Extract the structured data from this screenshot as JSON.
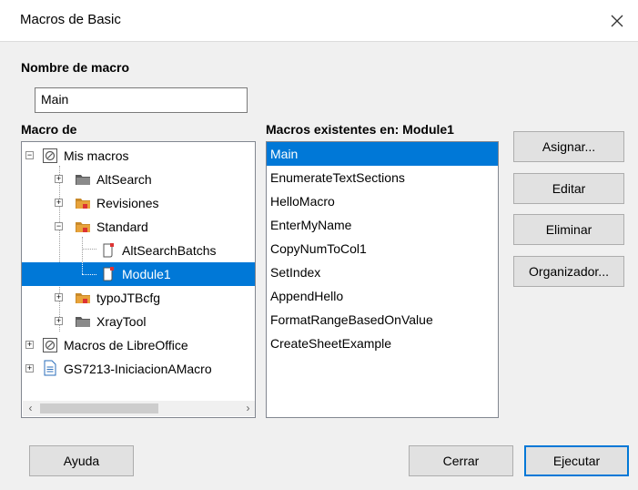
{
  "window": {
    "title": "Macros de Basic"
  },
  "macro_name": {
    "label": "Nombre de macro",
    "value": "Main"
  },
  "macro_from": {
    "label": "Macro de",
    "tree": [
      {
        "label": "Mis macros",
        "icon": "macro-library-icon"
      },
      {
        "label": "AltSearch",
        "icon": "folder-dark-icon"
      },
      {
        "label": "Revisiones",
        "icon": "folder-icon"
      },
      {
        "label": "Standard",
        "icon": "folder-icon"
      },
      {
        "label": "AltSearchBatchs",
        "icon": "module-icon"
      },
      {
        "label": "Module1",
        "icon": "module-icon"
      },
      {
        "label": "typoJTBcfg",
        "icon": "folder-icon"
      },
      {
        "label": "XrayTool",
        "icon": "folder-dark-icon"
      },
      {
        "label": "Macros de LibreOffice",
        "icon": "macro-library-icon"
      },
      {
        "label": "GS7213-IniciacionAMacro",
        "icon": "document-icon"
      }
    ]
  },
  "existing": {
    "label": "Macros existentes en: Module1",
    "items": [
      "Main",
      "EnumerateTextSections",
      "HelloMacro",
      "EnterMyName",
      "CopyNumToCol1",
      "SetIndex",
      "AppendHello",
      "FormatRangeBasedOnValue",
      "CreateSheetExample"
    ]
  },
  "buttons": {
    "assign": "Asignar...",
    "edit": "Editar",
    "delete": "Eliminar",
    "organizer": "Organizador...",
    "help": "Ayuda",
    "close": "Cerrar",
    "run": "Ejecutar"
  },
  "colors": {
    "selection": "#0078d7",
    "folder": "#e8a33a",
    "dialog_bg": "#f0f0f0"
  }
}
